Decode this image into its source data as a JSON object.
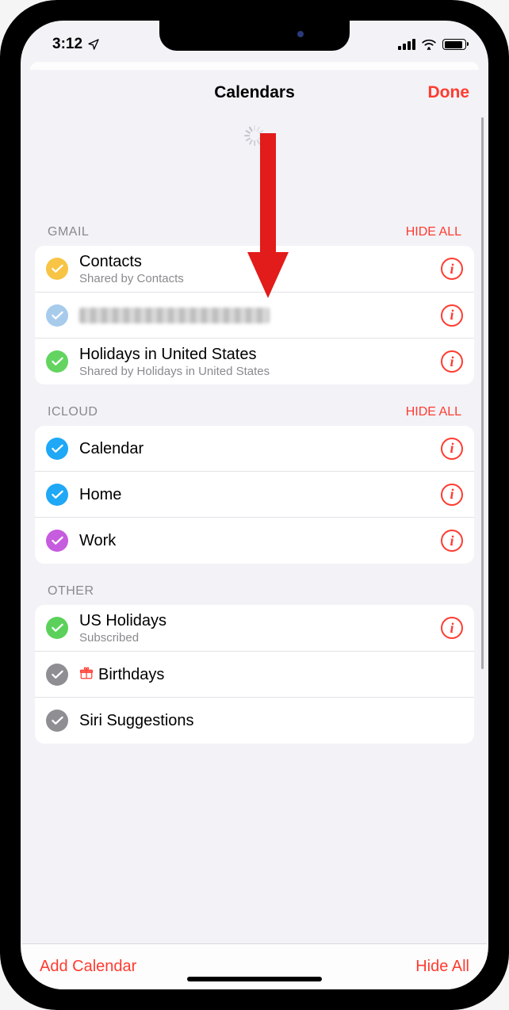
{
  "status": {
    "time": "3:12",
    "battery_percent": 90
  },
  "sheet": {
    "title": "Calendars",
    "done": "Done"
  },
  "colors": {
    "accent": "#ff3b30",
    "gmail_contacts": "#f7c445",
    "gmail_redacted": "#a7cbeb",
    "gmail_holidays": "#63d460",
    "icloud_calendar": "#1fa8f6",
    "icloud_home": "#1fa8f6",
    "icloud_work": "#c65cde",
    "other_us_holidays": "#5bd15b",
    "other_birthdays": "#8e8e93",
    "other_siri": "#8e8e93"
  },
  "sections": [
    {
      "label": "GMAIL",
      "action": "HIDE ALL",
      "items": [
        {
          "title": "Contacts",
          "sub": "Shared by Contacts",
          "check_color": "gmail_contacts",
          "info": true,
          "blurred": false
        },
        {
          "title": "",
          "sub": "",
          "check_color": "gmail_redacted",
          "info": true,
          "blurred": true
        },
        {
          "title": "Holidays in United States",
          "sub": "Shared by Holidays in United States",
          "check_color": "gmail_holidays",
          "info": true,
          "blurred": false
        }
      ]
    },
    {
      "label": "ICLOUD",
      "action": "HIDE ALL",
      "items": [
        {
          "title": "Calendar",
          "sub": "",
          "check_color": "icloud_calendar",
          "info": true,
          "blurred": false
        },
        {
          "title": "Home",
          "sub": "",
          "check_color": "icloud_home",
          "info": true,
          "blurred": false
        },
        {
          "title": "Work",
          "sub": "",
          "check_color": "icloud_work",
          "info": true,
          "blurred": false
        }
      ]
    },
    {
      "label": "OTHER",
      "action": "",
      "items": [
        {
          "title": "US Holidays",
          "sub": "Subscribed",
          "check_color": "other_us_holidays",
          "info": true,
          "blurred": false,
          "icon": ""
        },
        {
          "title": "Birthdays",
          "sub": "",
          "check_color": "other_birthdays",
          "info": false,
          "blurred": false,
          "icon": "gift"
        },
        {
          "title": "Siri Suggestions",
          "sub": "",
          "check_color": "other_siri",
          "info": false,
          "blurred": false,
          "icon": ""
        }
      ]
    }
  ],
  "bottom": {
    "add": "Add Calendar",
    "hide_all": "Hide All"
  },
  "info_glyph": "i",
  "gift_glyph": "🎁"
}
